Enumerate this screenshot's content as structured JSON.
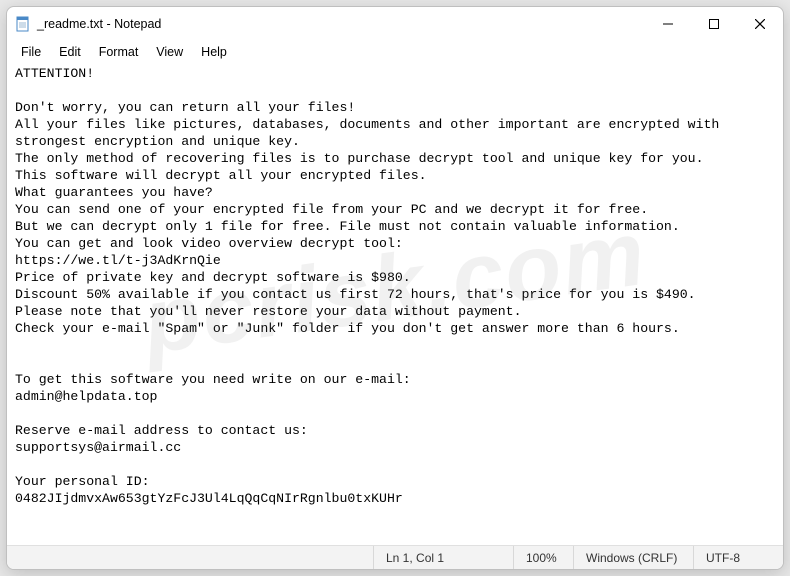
{
  "titlebar": {
    "title": "_readme.txt - Notepad"
  },
  "menubar": {
    "items": [
      {
        "label": "File"
      },
      {
        "label": "Edit"
      },
      {
        "label": "Format"
      },
      {
        "label": "View"
      },
      {
        "label": "Help"
      }
    ]
  },
  "content": {
    "text": "ATTENTION!\n\nDon't worry, you can return all your files!\nAll your files like pictures, databases, documents and other important are encrypted with strongest encryption and unique key.\nThe only method of recovering files is to purchase decrypt tool and unique key for you.\nThis software will decrypt all your encrypted files.\nWhat guarantees you have?\nYou can send one of your encrypted file from your PC and we decrypt it for free.\nBut we can decrypt only 1 file for free. File must not contain valuable information.\nYou can get and look video overview decrypt tool:\nhttps://we.tl/t-j3AdKrnQie\nPrice of private key and decrypt software is $980.\nDiscount 50% available if you contact us first 72 hours, that's price for you is $490.\nPlease note that you'll never restore your data without payment.\nCheck your e-mail \"Spam\" or \"Junk\" folder if you don't get answer more than 6 hours.\n\n\nTo get this software you need write on our e-mail:\nadmin@helpdata.top\n\nReserve e-mail address to contact us:\nsupportsys@airmail.cc\n\nYour personal ID:\n0482JIjdmvxAw653gtYzFcJ3Ul4LqQqCqNIrRgnlbu0txKUHr"
  },
  "statusbar": {
    "position": "Ln 1, Col 1",
    "zoom": "100%",
    "line_ending": "Windows (CRLF)",
    "encoding": "UTF-8"
  },
  "watermark": "pcrisk.com"
}
